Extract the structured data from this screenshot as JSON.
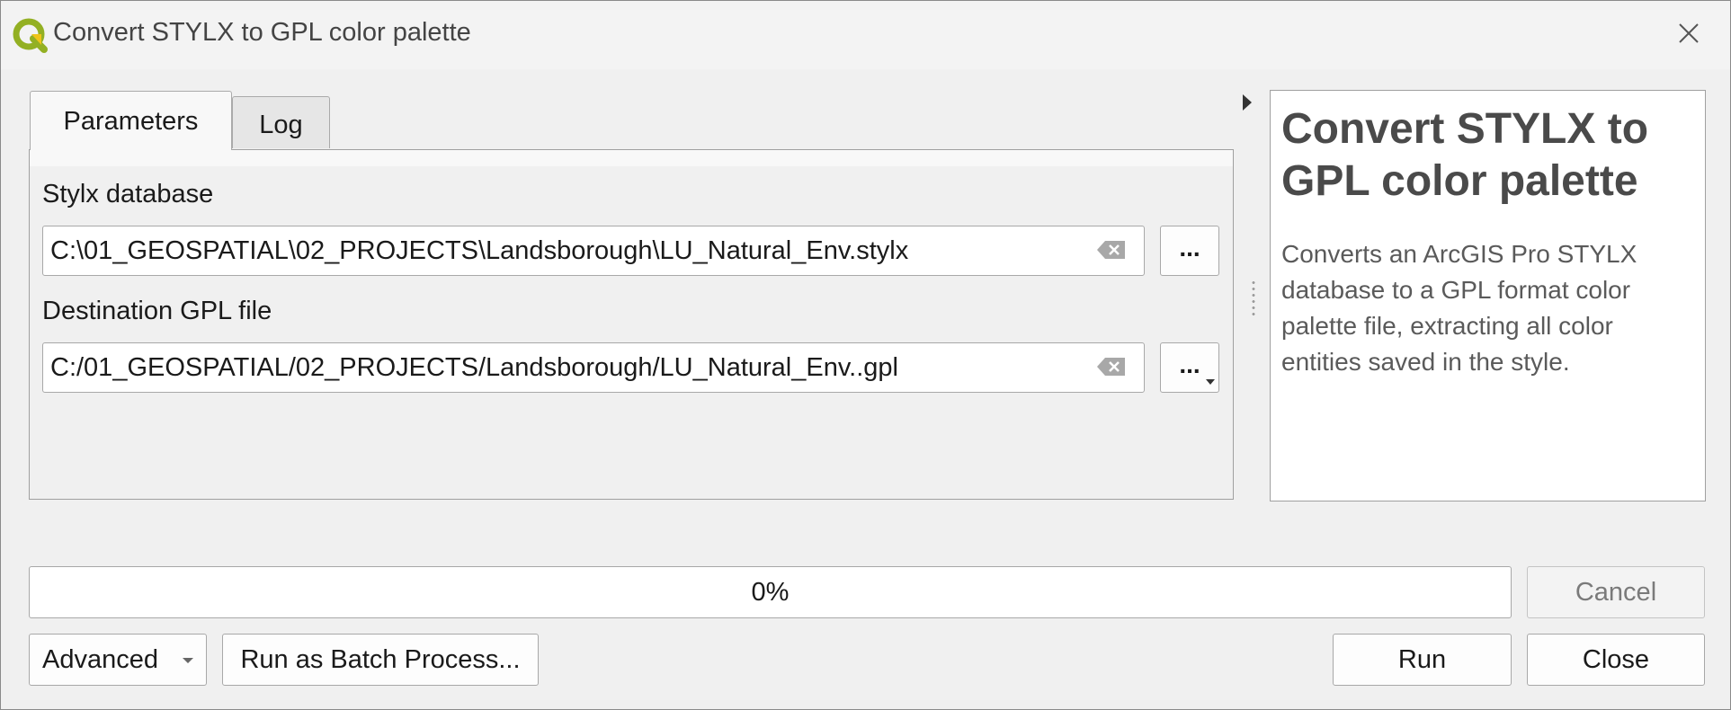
{
  "window": {
    "title": "Convert STYLX to GPL color palette",
    "close_icon": "close-icon"
  },
  "tabs": [
    {
      "label": "Parameters",
      "active": true
    },
    {
      "label": "Log",
      "active": false
    }
  ],
  "parameters": {
    "stylx": {
      "label": "Stylx database",
      "value": "C:\\01_GEOSPATIAL\\02_PROJECTS\\Landsborough\\LU_Natural_Env.stylx",
      "browse_label": "..."
    },
    "gpl": {
      "label": "Destination GPL file",
      "value": "C:/01_GEOSPATIAL/02_PROJECTS/Landsborough/LU_Natural_Env..gpl",
      "browse_label": "..."
    }
  },
  "help": {
    "title": "Convert STYLX to GPL color palette",
    "description": "Converts an ArcGIS Pro STYLX database to a GPL format color palette file, extracting all color entities saved in the style."
  },
  "progress": {
    "value": 0,
    "label": "0%"
  },
  "buttons": {
    "cancel": "Cancel",
    "advanced": "Advanced",
    "batch": "Run as Batch Process...",
    "run": "Run",
    "close": "Close"
  },
  "colors": {
    "qgis_green": "#93b023",
    "qgis_yellow": "#f0c419",
    "window_bg": "#f0f0f0"
  }
}
